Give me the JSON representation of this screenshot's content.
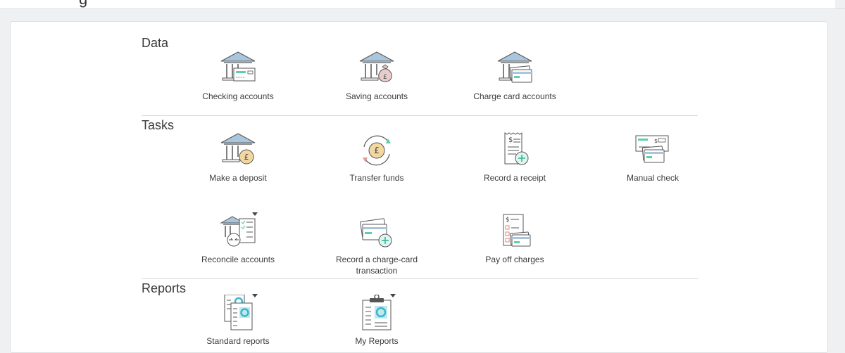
{
  "page": {
    "title_fragment": "g"
  },
  "sections": {
    "data": {
      "title": "Data",
      "tiles": [
        {
          "label": "Checking accounts",
          "icon": "bank-check-icon"
        },
        {
          "label": "Saving accounts",
          "icon": "bank-moneybag-icon"
        },
        {
          "label": "Charge card accounts",
          "icon": "bank-card-icon"
        }
      ]
    },
    "tasks": {
      "title": "Tasks",
      "tiles": [
        {
          "label": "Make a deposit",
          "icon": "bank-pound-icon"
        },
        {
          "label": "Transfer funds",
          "icon": "pound-cycle-icon"
        },
        {
          "label": "Record a receipt",
          "icon": "receipt-plus-icon"
        },
        {
          "label": "Manual check",
          "icon": "check-card-icon"
        },
        {
          "label": "Reconcile accounts",
          "icon": "reconcile-icon",
          "has_dropdown": true
        },
        {
          "label": "Record a charge-card transaction",
          "icon": "card-plus-icon"
        },
        {
          "label": "Pay off charges",
          "icon": "checklist-card-icon"
        }
      ]
    },
    "reports": {
      "title": "Reports",
      "tiles": [
        {
          "label": "Standard reports",
          "icon": "reports-icon",
          "has_dropdown": true
        },
        {
          "label": "My Reports",
          "icon": "clipboard-report-icon",
          "has_dropdown": true
        }
      ]
    }
  },
  "colors": {
    "icon_stroke": "#555555",
    "icon_blue": "#a9c6dd",
    "icon_green": "#5fcfa6",
    "icon_teal": "#3bb5c9",
    "coin": "#f2d7a1"
  }
}
